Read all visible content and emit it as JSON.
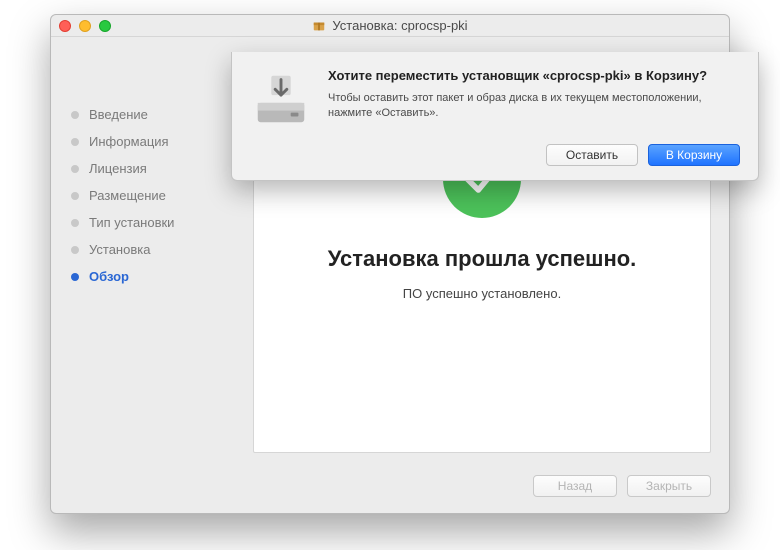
{
  "window": {
    "title": "Установка: cprocsp-pki"
  },
  "sidebar": {
    "steps": [
      {
        "label": "Введение",
        "active": false
      },
      {
        "label": "Информация",
        "active": false
      },
      {
        "label": "Лицензия",
        "active": false
      },
      {
        "label": "Размещение",
        "active": false
      },
      {
        "label": "Тип установки",
        "active": false
      },
      {
        "label": "Установка",
        "active": false
      },
      {
        "label": "Обзор",
        "active": true
      }
    ]
  },
  "main": {
    "success_title": "Установка прошла успешно.",
    "success_sub": "ПО успешно установлено."
  },
  "footer": {
    "back": "Назад",
    "close": "Закрыть"
  },
  "sheet": {
    "title": "Хотите переместить установщик «cprocsp-pki» в Корзину?",
    "message": "Чтобы оставить этот пакет и образ диска в их текущем местоположении, нажмите «Оставить».",
    "keep": "Оставить",
    "trash": "В Корзину"
  }
}
